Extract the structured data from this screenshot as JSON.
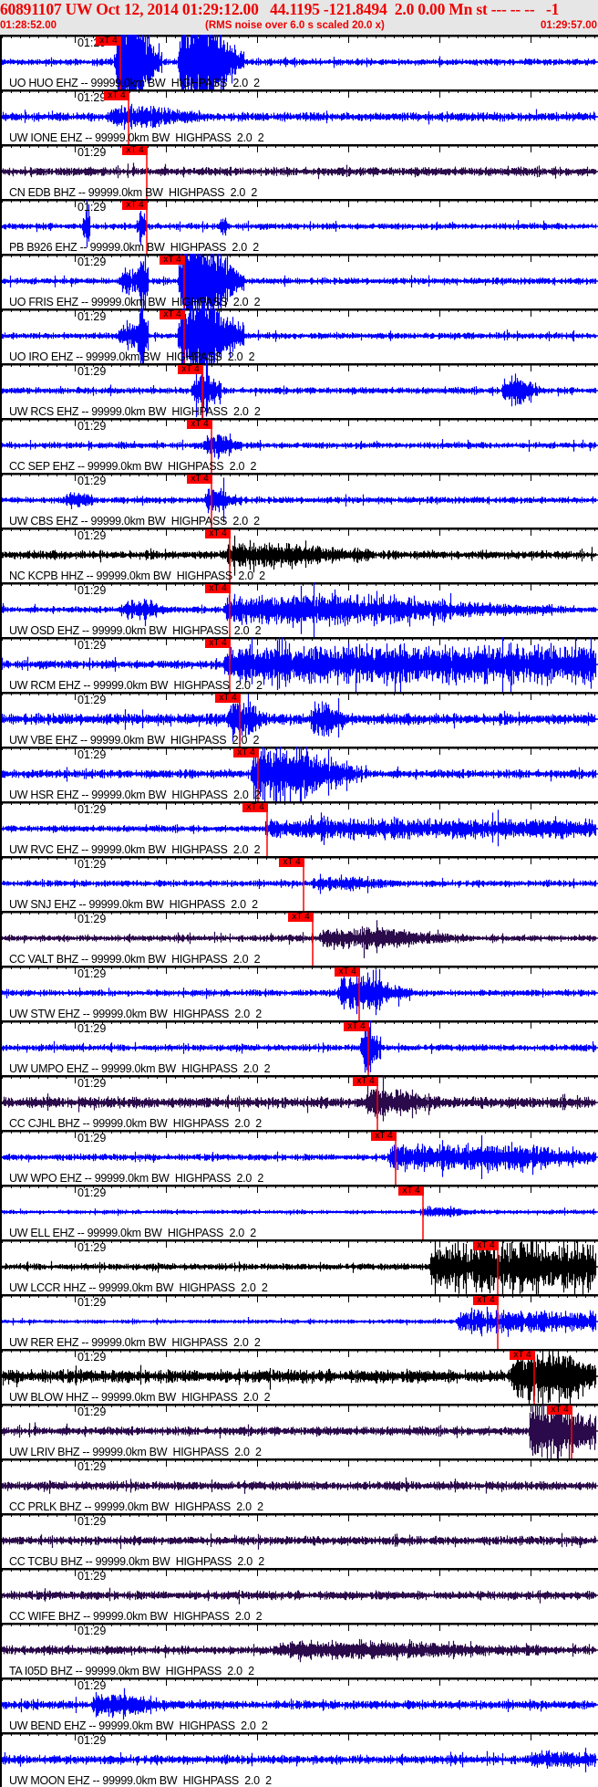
{
  "header": {
    "title": "60891107 UW Oct 12, 2014 01:29:12.00   44.1195 -121.8494  2.0 0.00 Mn st --- -- --   -1",
    "start_time": "01:28:52.00",
    "rms_note": "(RMS noise over 6.0 s scaled 20.0 x)",
    "end_time": "01:29:57.00"
  },
  "axis": {
    "minute_label": "01:29",
    "minute_offset_s": 8,
    "window_s": 65
  },
  "pick_label": "xT 4",
  "colors": {
    "blue": "#0000ff",
    "purple": "#2a0a4a",
    "black": "#000000",
    "pick": "#ff0000",
    "header_bg": "#e6e6e6",
    "title": "#ee0000"
  },
  "traces": [
    {
      "label": "UO HUO EHZ -- 99999.0km BW  HIGHPASS  2.0  2",
      "color": "blue",
      "pick_s": 13.0,
      "noise": 3,
      "bursts": [
        [
          12.5,
          60,
          2.5
        ],
        [
          19.5,
          60,
          3.5
        ]
      ]
    },
    {
      "label": "UW IONE EHZ -- 99999.0km BW  HIGHPASS  2.0  2",
      "color": "blue",
      "pick_s": 13.9,
      "noise": 4,
      "bursts": [
        [
          12,
          9,
          5
        ]
      ]
    },
    {
      "label": "CN EDB BHZ -- 99999.0km BW  HIGHPASS  2.0  2",
      "color": "purple",
      "pick_s": 15.9,
      "noise": 4,
      "bursts": []
    },
    {
      "label": "PB B926 EHZ -- 99999.0km BW  HIGHPASS  2.0  2",
      "color": "blue",
      "pick_s": 15.9,
      "noise": 3,
      "bursts": [
        [
          9,
          25,
          0.3
        ],
        [
          15,
          20,
          0.4
        ],
        [
          24,
          10,
          0.3
        ]
      ]
    },
    {
      "label": "UO FRIS EHZ -- 99999.0km BW  HIGHPASS  2.0  2",
      "color": "blue",
      "pick_s": 20.0,
      "noise": 3,
      "bursts": [
        [
          13,
          12,
          1.5
        ],
        [
          15,
          40,
          0.5
        ],
        [
          19.5,
          60,
          3.5
        ]
      ]
    },
    {
      "label": "UO IRO EHZ -- 99999.0km BW  HIGHPASS  2.0  2",
      "color": "blue",
      "pick_s": 20.0,
      "noise": 3,
      "bursts": [
        [
          13,
          12,
          1.5
        ],
        [
          15,
          40,
          0.5
        ],
        [
          19.5,
          60,
          3.5
        ]
      ]
    },
    {
      "label": "UW RCS EHZ -- 99999.0km BW  HIGHPASS  2.0  2",
      "color": "blue",
      "pick_s": 22.0,
      "noise": 3,
      "bursts": [
        [
          21,
          30,
          1.5
        ],
        [
          55,
          15,
          2
        ]
      ]
    },
    {
      "label": "CC SEP EHZ -- 99999.0km BW  HIGHPASS  2.0  2",
      "color": "blue",
      "pick_s": 23.0,
      "noise": 3,
      "bursts": [
        [
          22.3,
          12,
          2
        ]
      ]
    },
    {
      "label": "UW CBS EHZ -- 99999.0km BW  HIGHPASS  2.0  2",
      "color": "blue",
      "pick_s": 23.0,
      "noise": 3,
      "bursts": [
        [
          7,
          9,
          1.5
        ],
        [
          22.3,
          11,
          2
        ]
      ]
    },
    {
      "label": "NC KCPB HHZ -- 99999.0km BW  HIGHPASS  2.0  2",
      "color": "black",
      "pick_s": 25.0,
      "noise": 4,
      "bursts": [
        [
          24.5,
          10,
          8
        ]
      ]
    },
    {
      "label": "UW OSD EHZ -- 99999.0km BW  HIGHPASS  2.0  2",
      "color": "blue",
      "pick_s": 25.0,
      "noise": 3,
      "bursts": [
        [
          13,
          9,
          3
        ],
        [
          24.5,
          14,
          18
        ]
      ]
    },
    {
      "label": "UW RCM EHZ -- 99999.0km BW  HIGHPASS  2.0  2",
      "color": "blue",
      "pick_s": 25.0,
      "noise": 4,
      "bursts": [
        [
          24.5,
          18,
          40
        ]
      ]
    },
    {
      "label": "UW VBE EHZ -- 99999.0km BW  HIGHPASS  2.0  2",
      "color": "blue",
      "pick_s": 26.1,
      "noise": 5,
      "bursts": [
        [
          25,
          20,
          2
        ],
        [
          34,
          15,
          2
        ]
      ]
    },
    {
      "label": "UW HSR EHZ -- 99999.0km BW  HIGHPASS  2.0  2",
      "color": "blue",
      "pick_s": 28.1,
      "noise": 4,
      "bursts": [
        [
          27.5,
          28,
          6
        ]
      ]
    },
    {
      "label": "UW RVC EHZ -- 99999.0km BW  HIGHPASS  2.0  2",
      "color": "blue",
      "pick_s": 29.1,
      "noise": 3,
      "bursts": [
        [
          29,
          8,
          36
        ]
      ]
    },
    {
      "label": "UW SNJ EHZ -- 99999.0km BW  HIGHPASS  2.0  2",
      "color": "blue",
      "pick_s": 33.1,
      "noise": 3,
      "bursts": [
        [
          34,
          5,
          5
        ]
      ]
    },
    {
      "label": "CC VALT BHZ -- 99999.0km BW  HIGHPASS  2.0  2",
      "color": "purple",
      "pick_s": 34.1,
      "noise": 3,
      "bursts": [
        [
          35,
          10,
          8
        ]
      ]
    },
    {
      "label": "UW STW EHZ -- 99999.0km BW  HIGHPASS  2.0  2",
      "color": "blue",
      "pick_s": 39.2,
      "noise": 3,
      "bursts": [
        [
          37,
          20,
          4
        ]
      ]
    },
    {
      "label": "UW UMPO EHZ -- 99999.0km BW  HIGHPASS  2.0  2",
      "color": "blue",
      "pick_s": 40.2,
      "noise": 3,
      "bursts": [
        [
          39.5,
          30,
          1
        ]
      ]
    },
    {
      "label": "CC CJHL BHZ -- 99999.0km BW  HIGHPASS  2.0  2",
      "color": "purple",
      "pick_s": 41.2,
      "noise": 5,
      "bursts": [
        [
          40,
          12,
          4
        ]
      ]
    },
    {
      "label": "UW WPO EHZ -- 99999.0km BW  HIGHPASS  2.0  2",
      "color": "blue",
      "pick_s": 43.2,
      "noise": 3,
      "bursts": [
        [
          42.5,
          12,
          15
        ]
      ]
    },
    {
      "label": "UW ELL EHZ -- 99999.0km BW  HIGHPASS  2.0  2",
      "color": "blue",
      "pick_s": 46.2,
      "noise": 2,
      "bursts": [
        [
          46,
          4,
          3
        ]
      ]
    },
    {
      "label": "UW LCCR HHZ -- 99999.0km BW  HIGHPASS  2.0  2",
      "color": "black",
      "pick_s": 54.4,
      "noise": 3,
      "bursts": [
        [
          47,
          25,
          18
        ]
      ]
    },
    {
      "label": "UW RER EHZ -- 99999.0km BW  HIGHPASS  2.0  2",
      "color": "blue",
      "pick_s": 54.4,
      "noise": 2,
      "bursts": [
        [
          50,
          10,
          15
        ]
      ]
    },
    {
      "label": "UW BLOW HHZ -- 99999.0km BW  HIGHPASS  2.0  2",
      "color": "black",
      "pick_s": 58.4,
      "noise": 6,
      "bursts": [
        [
          56,
          25,
          6
        ]
      ]
    },
    {
      "label": "UW LRIV BHZ -- 99999.0km BW  HIGHPASS  2.0  2",
      "color": "purple",
      "pick_s": 62.5,
      "noise": 4,
      "bursts": [
        [
          58,
          30,
          5
        ]
      ]
    },
    {
      "label": "CC PRLK BHZ -- 99999.0km BW  HIGHPASS  2.0  2",
      "color": "purple",
      "pick_s": null,
      "noise": 4,
      "bursts": []
    },
    {
      "label": "CC TCBU BHZ -- 99999.0km BW  HIGHPASS  2.0  2",
      "color": "purple",
      "pick_s": null,
      "noise": 4,
      "bursts": []
    },
    {
      "label": "CC WIFE BHZ -- 99999.0km BW  HIGHPASS  2.0  2",
      "color": "purple",
      "pick_s": null,
      "noise": 4,
      "bursts": []
    },
    {
      "label": "TA I05D BHZ -- 99999.0km BW  HIGHPASS  2.0  2",
      "color": "purple",
      "pick_s": null,
      "noise": 4,
      "bursts": [
        [
          30,
          6,
          15
        ]
      ]
    },
    {
      "label": "UW BEND EHZ -- 99999.0km BW  HIGHPASS  2.0  2",
      "color": "blue",
      "pick_s": null,
      "noise": 4,
      "bursts": [
        [
          10,
          10,
          4
        ]
      ]
    },
    {
      "label": "UW MOON EHZ -- 99999.0km BW  HIGHPASS  2.0  2",
      "color": "blue",
      "pick_s": null,
      "noise": 4,
      "bursts": [
        [
          58,
          5,
          6
        ]
      ]
    }
  ]
}
